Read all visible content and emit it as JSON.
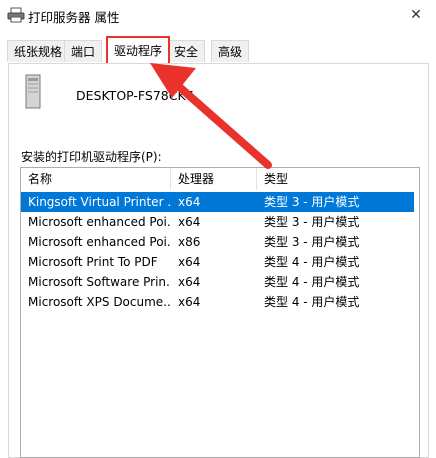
{
  "window": {
    "title": "打印服务器 属性",
    "close_glyph": "✕"
  },
  "tabs": [
    {
      "label": "纸张规格",
      "selected": false
    },
    {
      "label": "端口",
      "selected": false
    },
    {
      "label": "驱动程序",
      "selected": true
    },
    {
      "label": "安全",
      "selected": false
    },
    {
      "label": "高级",
      "selected": false
    }
  ],
  "server": {
    "name": "DESKTOP-FS78CK7"
  },
  "drivers": {
    "section_label": "安装的打印机驱动程序(P):",
    "columns": [
      "名称",
      "处理器",
      "类型"
    ],
    "rows": [
      {
        "name": "Kingsoft Virtual Printer ...",
        "processor": "x64",
        "type": "类型 3 - 用户模式",
        "selected": true
      },
      {
        "name": "Microsoft enhanced Poi...",
        "processor": "x64",
        "type": "类型 3 - 用户模式",
        "selected": false
      },
      {
        "name": "Microsoft enhanced Poi...",
        "processor": "x86",
        "type": "类型 3 - 用户模式",
        "selected": false
      },
      {
        "name": "Microsoft Print To PDF",
        "processor": "x64",
        "type": "类型 4 - 用户模式",
        "selected": false
      },
      {
        "name": "Microsoft Software Prin...",
        "processor": "x64",
        "type": "类型 4 - 用户模式",
        "selected": false
      },
      {
        "name": "Microsoft XPS Docume...",
        "processor": "x64",
        "type": "类型 4 - 用户模式",
        "selected": false
      }
    ]
  },
  "colors": {
    "highlight": "#e8322b",
    "selection": "#0078d7"
  },
  "icons": {
    "title": "printer-icon",
    "server": "computer-tower-icon",
    "close": "close-icon",
    "annotation": "red-arrow"
  }
}
